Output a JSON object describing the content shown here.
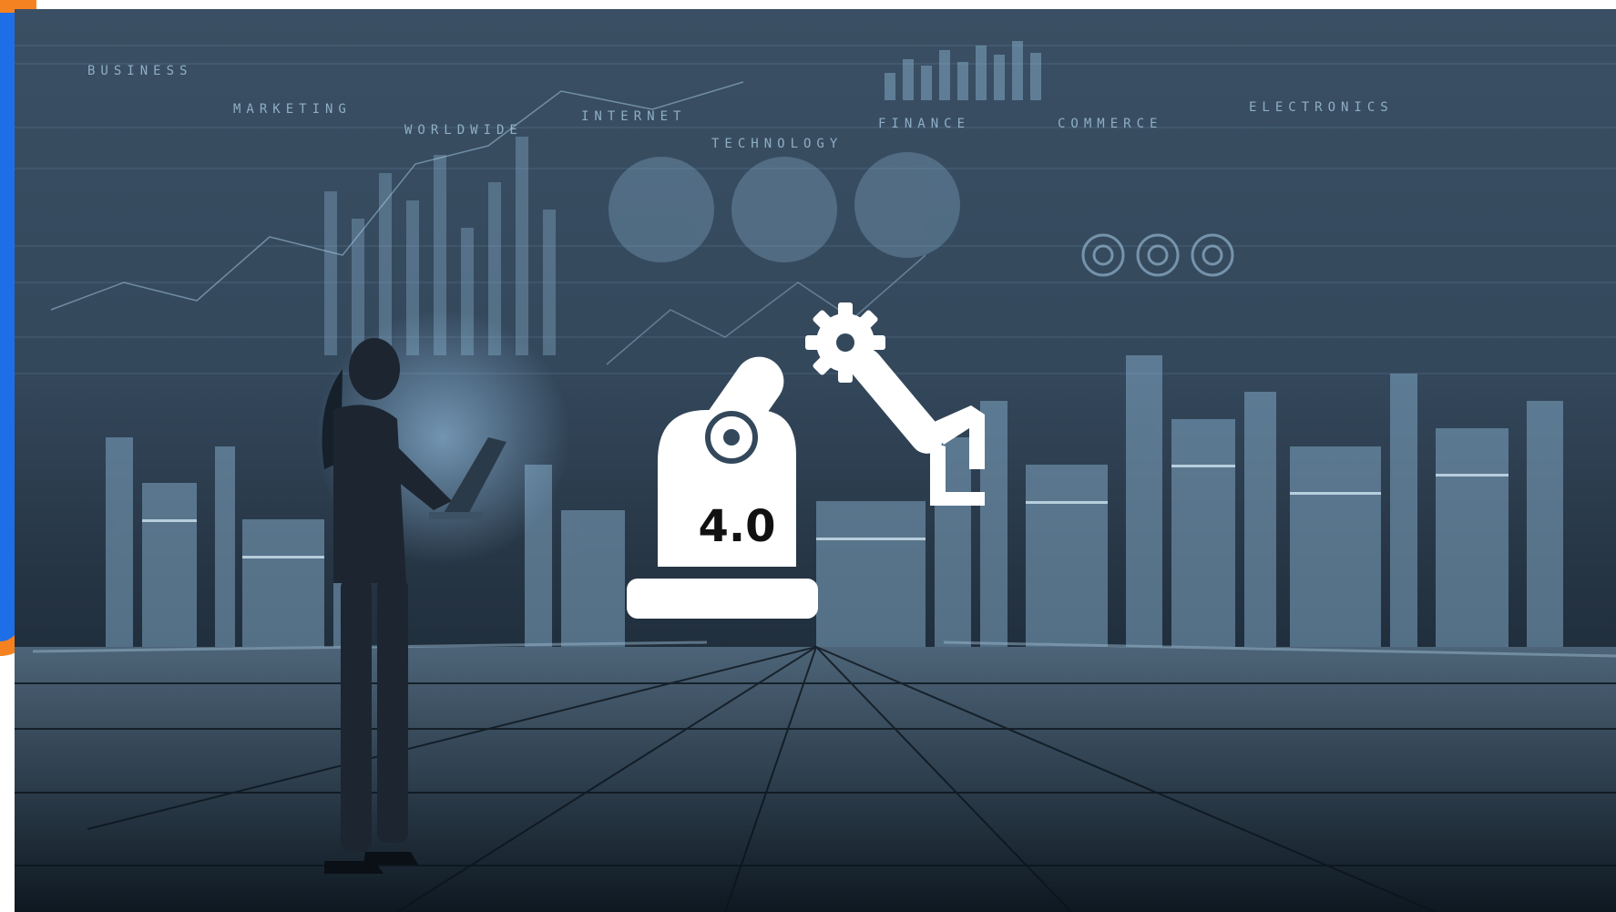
{
  "keywords": {
    "business": "BUSINESS",
    "marketing": "MARKETING",
    "worldwide": "WORLDWIDE",
    "internet": "INTERNET",
    "technology": "TECHNOLOGY",
    "finance": "FINANCE",
    "commerce": "COMMERCE",
    "electronics": "ELECTRONICS"
  },
  "robot": {
    "label": "4.0",
    "icon": "robot-arm-gear-icon"
  },
  "colors": {
    "accent_orange": "#f58220",
    "accent_blue": "#1e6ee8",
    "hero_tint": "#3a4f63",
    "icon_white": "#ffffff"
  }
}
